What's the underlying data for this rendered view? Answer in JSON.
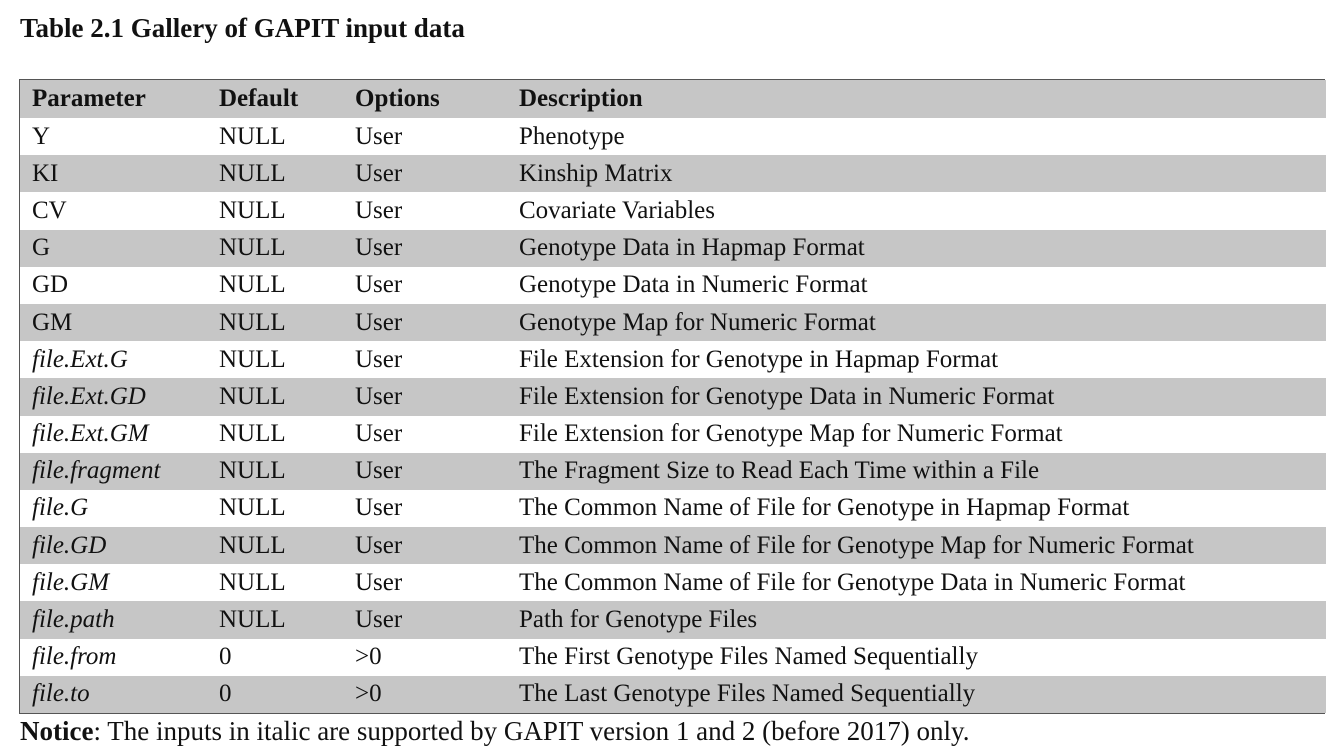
{
  "caption": "Table 2.1 Gallery of GAPIT input data",
  "table": {
    "headers": [
      "Parameter",
      "Default",
      "Options",
      "Description"
    ],
    "rows": [
      {
        "parameter": "Y",
        "default": "NULL",
        "options": "User",
        "description": "Phenotype",
        "italic": false
      },
      {
        "parameter": "KI",
        "default": "NULL",
        "options": "User",
        "description": "Kinship Matrix",
        "italic": false
      },
      {
        "parameter": "CV",
        "default": "NULL",
        "options": "User",
        "description": "Covariate Variables",
        "italic": false
      },
      {
        "parameter": "G",
        "default": "NULL",
        "options": "User",
        "description": "Genotype Data in Hapmap Format",
        "italic": false
      },
      {
        "parameter": "GD",
        "default": "NULL",
        "options": "User",
        "description": "Genotype Data in Numeric Format",
        "italic": false
      },
      {
        "parameter": "GM",
        "default": "NULL",
        "options": "User",
        "description": "Genotype Map for Numeric Format",
        "italic": false
      },
      {
        "parameter": "file.Ext.G",
        "default": "NULL",
        "options": "User",
        "description": "File Extension for Genotype in Hapmap Format",
        "italic": true
      },
      {
        "parameter": "file.Ext.GD",
        "default": "NULL",
        "options": "User",
        "description": "File Extension for Genotype Data in Numeric Format",
        "italic": true
      },
      {
        "parameter": "file.Ext.GM",
        "default": "NULL",
        "options": "User",
        "description": "File Extension for Genotype Map for Numeric Format",
        "italic": true
      },
      {
        "parameter": "file.fragment",
        "default": "NULL",
        "options": "User",
        "description": "The Fragment Size to Read Each Time within a File",
        "italic": true
      },
      {
        "parameter": "file.G",
        "default": "NULL",
        "options": "User",
        "description": "The Common Name of File for Genotype in Hapmap Format",
        "italic": true
      },
      {
        "parameter": "file.GD",
        "default": "NULL",
        "options": "User",
        "description": "The Common Name of File for Genotype Map for Numeric Format",
        "italic": true
      },
      {
        "parameter": "file.GM",
        "default": "NULL",
        "options": "User",
        "description": "The Common Name of File for Genotype Data in Numeric Format",
        "italic": true
      },
      {
        "parameter": "file.path",
        "default": "NULL",
        "options": "User",
        "description": "Path for Genotype Files",
        "italic": true
      },
      {
        "parameter": "file.from",
        "default": "0",
        "options": ">0",
        "description": "The First Genotype Files Named Sequentially",
        "italic": true
      },
      {
        "parameter": "file.to",
        "default": "0",
        "options": ">0",
        "description": "The Last Genotype Files Named Sequentially",
        "italic": true
      }
    ]
  },
  "notice": {
    "label": "Notice",
    "text": ": The inputs in italic are supported by GAPIT version 1 and 2 (before 2017) only."
  },
  "colors": {
    "shade": "#c6c6c6",
    "border": "#555555"
  }
}
